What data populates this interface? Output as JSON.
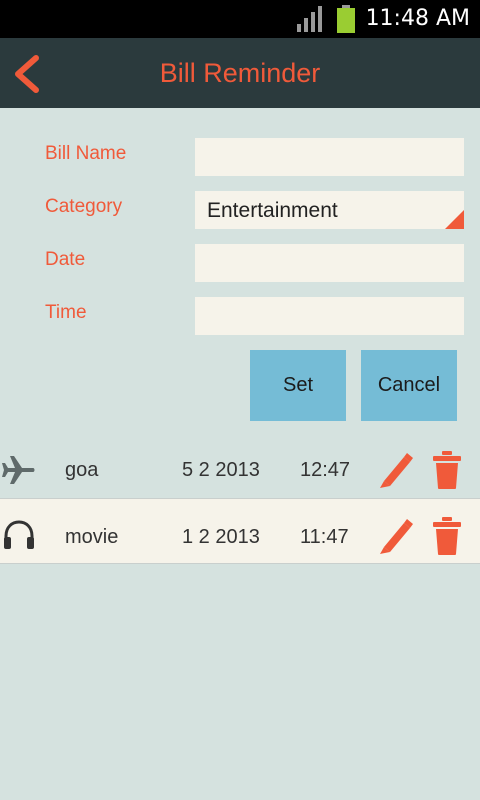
{
  "status_bar": {
    "time": "11:48 AM"
  },
  "header": {
    "title": "Bill Reminder"
  },
  "form": {
    "bill_name_label": "Bill Name",
    "bill_name_value": "",
    "category_label": "Category",
    "category_value": "Entertainment",
    "date_label": "Date",
    "date_value": "",
    "time_label": "Time",
    "time_value": ""
  },
  "actions": {
    "set_label": "Set",
    "cancel_label": "Cancel"
  },
  "reminders": [
    {
      "icon": "airplane-icon",
      "name": "goa",
      "date": "5 2 2013",
      "time": "12:47"
    },
    {
      "icon": "headphones-icon",
      "name": "movie",
      "date": "1 2 2013",
      "time": "11:47"
    }
  ],
  "colors": {
    "accent": "#f05a3a",
    "header_bg": "#2b3a3d",
    "button": "#75bcd6",
    "background": "#d5e2df",
    "field_bg": "#f6f3ea"
  }
}
